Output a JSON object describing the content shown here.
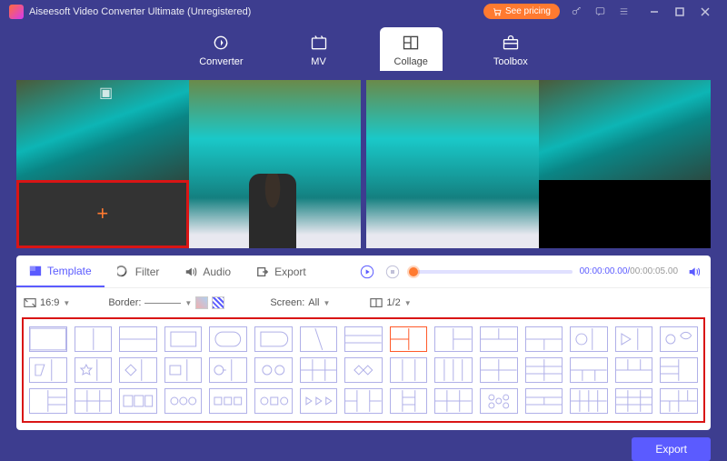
{
  "window": {
    "title": "Aiseesoft Video Converter Ultimate (Unregistered)"
  },
  "header": {
    "see_pricing": "See pricing",
    "tabs": [
      {
        "id": "converter",
        "label": "Converter"
      },
      {
        "id": "mv",
        "label": "MV"
      },
      {
        "id": "collage",
        "label": "Collage"
      },
      {
        "id": "toolbox",
        "label": "Toolbox"
      }
    ],
    "active_tab": "collage"
  },
  "subtabs": {
    "items": [
      {
        "id": "template",
        "label": "Template"
      },
      {
        "id": "filter",
        "label": "Filter"
      },
      {
        "id": "audio",
        "label": "Audio"
      },
      {
        "id": "export",
        "label": "Export"
      }
    ],
    "active": "template"
  },
  "player": {
    "position": "00:00:00.00",
    "duration": "00:00:05.00"
  },
  "toolbar": {
    "aspect_label": "16:9",
    "border_label": "Border:",
    "screen_label": "Screen:",
    "screen_value": "All",
    "split_value": "1/2"
  },
  "footer": {
    "export_label": "Export"
  }
}
